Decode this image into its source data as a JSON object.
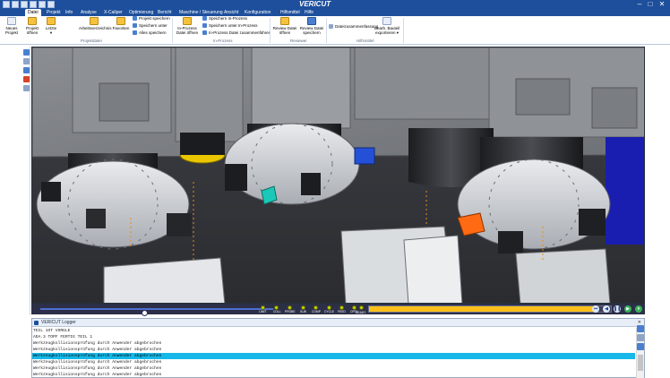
{
  "window": {
    "title": "VERICUT",
    "controls": [
      "–",
      "□",
      "✕"
    ],
    "quick_access": [
      "open-icon",
      "save-icon",
      "undo-icon",
      "redo-icon",
      "reset-icon",
      "play-icon"
    ]
  },
  "menu": {
    "tabs": [
      {
        "label": "Datei",
        "active": true
      },
      {
        "label": "Projekt"
      },
      {
        "label": "Info"
      },
      {
        "label": "Analyse"
      },
      {
        "label": "X-Caliper"
      },
      {
        "label": "Optimierung"
      },
      {
        "label": "Bericht"
      },
      {
        "label": "Maschine / Steuerung"
      },
      {
        "label": "Ansicht"
      },
      {
        "label": "Konfiguration"
      },
      {
        "label": "Hilfsmittel"
      },
      {
        "label": "Hilfe"
      }
    ]
  },
  "ribbon": {
    "neues_projekt": [
      "Neues",
      "Projekt"
    ],
    "projekt_oeffnen": [
      "Projekt",
      "öffnen"
    ],
    "letzte": [
      "Letzte",
      "▾"
    ],
    "arbeitsverzeichnis": "Arbeitsverzeichnis",
    "favoriten": "Favoriten",
    "projekt_speichern": "Projekt speichern",
    "speichern_unter": "Speichern unter",
    "alles_speichern": "Alles speichern",
    "inprozess_oeffnen": [
      "In-Prozess",
      "Datei öffnen"
    ],
    "speichern_inprozess": "Speichern In-Prozess",
    "speichern_unter_inprozess": "Speichern unter In-Prozess",
    "inprozess_zusammenfuehren": "In-Prozess Datei zusammenführen",
    "review_oeffnen": [
      "Review Datei",
      "öffnen"
    ],
    "review_speichern": [
      "Review Datei",
      "speichern"
    ],
    "dateizusammenfassung": "Dateizusammenfassung",
    "bauteil_exportieren": [
      "Bearb. Bauteil",
      "exportieren ▾"
    ],
    "groups": {
      "projektdatei": "Projektdatei",
      "inprozess": "In-Prozess",
      "reviewer": "Reviewer",
      "hilfsmittel": "Hilfsmittel"
    }
  },
  "animation": {
    "slider_position": 0.45,
    "indicators": [
      "LIMIT",
      "COLL",
      "PROBE",
      "SUB",
      "COMP",
      "CYCLE",
      "FEED",
      "OPTI",
      "READY"
    ],
    "progress": 0.93,
    "controls": [
      "rewind-icon",
      "step-icon",
      "pause-icon",
      "step-forward-icon",
      "play-icon"
    ]
  },
  "logger": {
    "title": "VERICUT Logger",
    "close": "✕",
    "lines": [
      "TEIL 1OT VORGLE",
      "ADA.3 TOPF FERTIG TEIL 1",
      "Werkzeugkollisionsprüfung durch Anwender abgebrochen",
      "Werkzeugkollisionsprüfung durch Anwender abgebrochen",
      "Werkzeugkollisionsprüfung durch Anwender abgebrochen",
      "Werkzeugkollisionsprüfung durch Anwender abgebrochen",
      "Werkzeugkollisionsprüfung durch Anwender abgebrochen",
      "Werkzeugkollisionsprüfung durch Anwender abgebrochen"
    ],
    "selected_index": 4
  },
  "colors": {
    "brand_blue": "#1d4f9c",
    "accent_cyan": "#15b8e8",
    "progress_amber": "#ffbf1a",
    "indicator_green": "#c8d400"
  }
}
